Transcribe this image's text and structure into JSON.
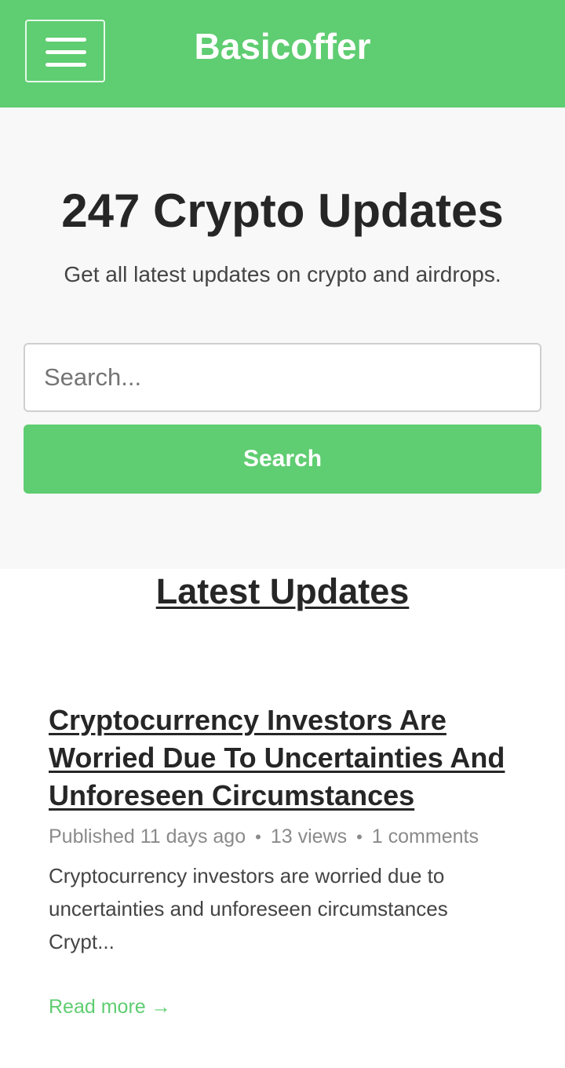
{
  "header": {
    "brand": "Basicoffer",
    "menu_icon": "hamburger-menu-icon"
  },
  "hero": {
    "title": "247 Crypto Updates",
    "subtitle": "Get all latest updates on crypto and airdrops.",
    "search_placeholder": "Search...",
    "search_value": "",
    "search_button_label": "Search"
  },
  "section": {
    "title": "Latest Updates"
  },
  "posts": [
    {
      "title": "Cryptocurrency Investors Are Worried Due To Uncertainties And Unforeseen Circumstances",
      "published": "Published 11 days ago",
      "views": "13 views",
      "comments": "1 comments",
      "separator": "•",
      "excerpt": "Cryptocurrency investors are worried due to uncertainties and unforeseen circumstances Crypt...",
      "read_more": "Read more →"
    }
  ],
  "colors": {
    "accent": "#5fcd71",
    "hero_background": "#f8f8f8",
    "text_dark": "#262626",
    "text_muted": "#8a8a8a"
  }
}
